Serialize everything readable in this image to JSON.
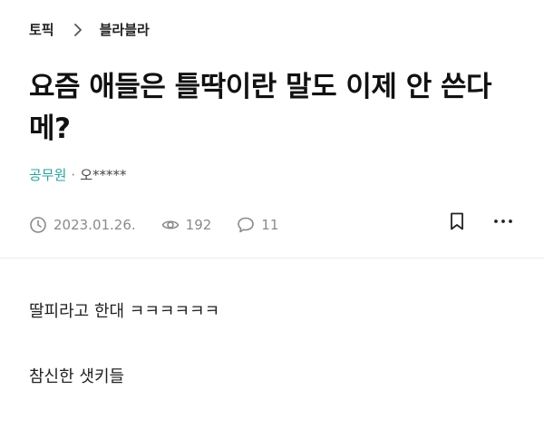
{
  "breadcrumb": {
    "topic": "토픽",
    "board": "블라블라"
  },
  "post": {
    "title": "요즘 애들은 틀딱이란 말도 이제 안 쓴다메?",
    "author_company": "공무원",
    "author_separator": "·",
    "author_nickname": "오*****",
    "date": "2023.01.26.",
    "views": "192",
    "comments": "11",
    "body_lines": [
      "딸피라고 한대 ㅋㅋㅋㅋㅋㅋ",
      "참신한 샛키들"
    ]
  },
  "colors": {
    "company_text": "#2ba0a0",
    "meta_text": "#8a8a8a",
    "divider": "#ececec"
  },
  "icons": {
    "breadcrumb_separator": "chevron-right-icon",
    "date": "clock-icon",
    "views": "eye-icon",
    "comments": "speech-bubble-icon",
    "bookmark": "bookmark-icon",
    "more": "more-horizontal-icon"
  }
}
